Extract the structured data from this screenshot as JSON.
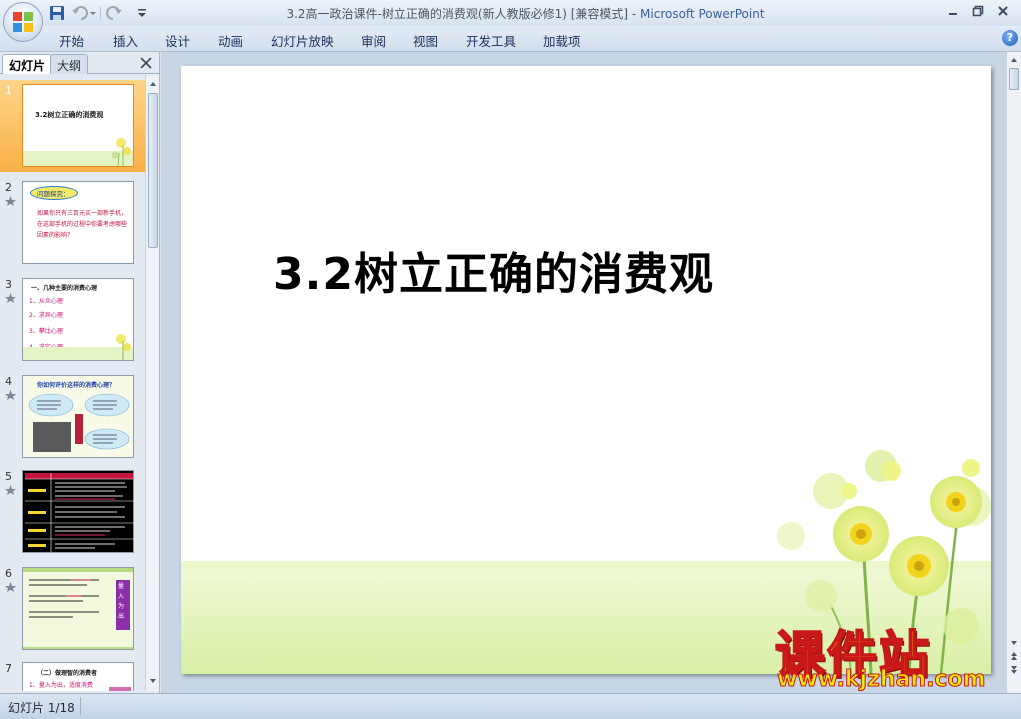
{
  "window": {
    "title": "3.2高一政治课件-树立正确的消费观(新人教版必修1) [兼容模式]",
    "title_sep": " - ",
    "app_name": "Microsoft PowerPoint"
  },
  "ribbon": {
    "tabs": [
      "开始",
      "插入",
      "设计",
      "动画",
      "幻灯片放映",
      "审阅",
      "视图",
      "开发工具",
      "加载项"
    ]
  },
  "panel": {
    "tab_slides": "幻灯片",
    "tab_outline": "大纲"
  },
  "thumbnails": [
    {
      "number": "1",
      "title": "3.2树立正确的消费观"
    },
    {
      "number": "2",
      "heading": "问题探究：",
      "body": "如果你只有三百元买一部新手机，在这部手机的过程中你要考虑哪些因素的影响？"
    },
    {
      "number": "3",
      "heading": "一、几种主要的消费心理",
      "items": [
        "1、从众心理",
        "2、求异心理",
        "3、攀比心理",
        "4、求实心理"
      ]
    },
    {
      "number": "4",
      "heading": "你如何评价这样的消费心理？"
    },
    {
      "number": "5"
    },
    {
      "number": "6",
      "side_text": "量入为出"
    },
    {
      "number": "7",
      "heading": "（二）做理智的消费者",
      "items": [
        "1、量入为出，适度消费"
      ]
    }
  ],
  "slide": {
    "title": "3.2树立正确的消费观"
  },
  "status": {
    "slide_indicator": "幻灯片 1/18"
  },
  "watermark": {
    "main": "课件站",
    "url": "www.kjzhan.com"
  },
  "colors": {
    "selected_thumb": "#f8b047",
    "ribbon_text": "#17315e",
    "app_name": "#3b5f9c",
    "thumb_heading_red": "#c0143c",
    "thumb_list_magenta": "#cc1177"
  }
}
